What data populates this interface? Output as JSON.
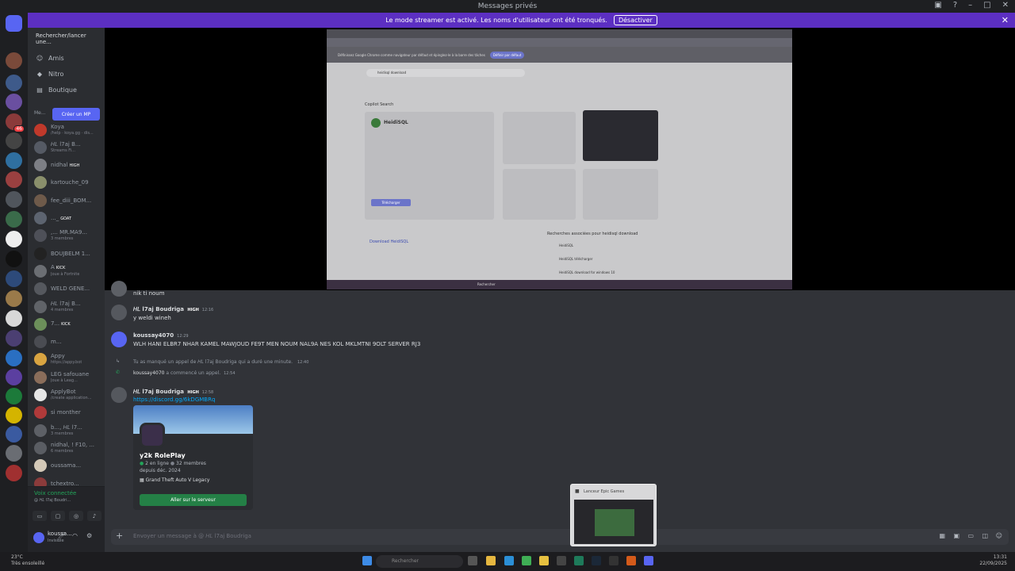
{
  "window": {
    "title": "Messages privés"
  },
  "streamer_bar": {
    "text": "Le mode streamer est activé. Les noms d'utilisateur ont été tronqués.",
    "button": "Désactiver"
  },
  "sidebar": {
    "search": "Rechercher/lancer une...",
    "nav": [
      {
        "label": "Amis",
        "icon": "friends-icon"
      },
      {
        "label": "Nitro",
        "icon": "nitro-icon"
      },
      {
        "label": "Boutique",
        "icon": "shop-icon"
      }
    ],
    "dm_header": "Me...",
    "create_dm": "Créer un MP",
    "dms": [
      {
        "name": "Koya",
        "sub": "/help · koya.gg · dis...",
        "color": "#c0392b"
      },
      {
        "name": "𝐻𝐿 l7aj B...",
        "sub": "Streams Fi...",
        "color": "#555a64"
      },
      {
        "name": "nidhal",
        "tag": "HIGH",
        "color": "#7d7f85"
      },
      {
        "name": "kartouche_09",
        "color": "#8a8f6b"
      },
      {
        "name": "fee_diii_BOM...",
        "color": "#6e5a4a"
      },
      {
        "name": "..._",
        "tag": "GOAT",
        "color": "#5d6470"
      },
      {
        "name": ",... MR.MA9...",
        "sub": "3 membres",
        "color": "#4e5058"
      },
      {
        "name": "BOUJBELM 1...",
        "color": "#222"
      },
      {
        "name": "A",
        "tag": "KICK",
        "sub": "Joue à Fortnite",
        "color": "#6b6e73"
      },
      {
        "name": "WELD GENE...",
        "color": "#55585e"
      },
      {
        "name": "𝐻𝐿 l7aj B...",
        "sub": "4 membres",
        "color": "#606368"
      },
      {
        "name": "7...",
        "tag": "KICK",
        "color": "#6c8f5a"
      },
      {
        "name": "m...",
        "color": "#4a4c52"
      },
      {
        "name": "Appy",
        "sub": "https://appy.bot",
        "color": "#d9a441"
      },
      {
        "name": "LEG safouane",
        "sub": "Joue à Leag...",
        "color": "#8a6d5a"
      },
      {
        "name": "ApplyBot",
        "sub": "/create application...",
        "color": "#e6e6e6"
      },
      {
        "name": "si monther",
        "color": "#b03a3a"
      },
      {
        "name": "b..., 𝐻𝐿 l7...",
        "sub": "3 membres",
        "color": "#5d6066"
      },
      {
        "name": "nidhal, ! F10, ...",
        "sub": "6 membres",
        "color": "#5a5d63"
      },
      {
        "name": "oussama...",
        "color": "#d4c9b8"
      },
      {
        "name": "tchextro...",
        "color": "#8b3b3b"
      }
    ],
    "voice": {
      "status": "Voix connectée",
      "sub": "@ 𝐻𝐿 l7aj Boudri..."
    },
    "user": {
      "name": "koussa...",
      "status": "Invisible"
    }
  },
  "stream": {
    "infobar_text": "Définissez Google Chrome comme navigateur par défaut et épinglez-le à la barre des tâches",
    "infobar_button": "Définir par défaut",
    "search_query": "heidisql download",
    "copilot": "Copilot Search",
    "result_title": "HeidiSQL",
    "download_btn": "Télécharger",
    "related": "Recherches associées pour heidisql download",
    "related_items": [
      "HeidiSQL",
      "HeidiSQL télécharger",
      "HeidiSQL download for windows 10"
    ],
    "download_link": "Download HeidiSQL",
    "taskbar_search": "Rechercher"
  },
  "messages": [
    {
      "type": "tail",
      "text": "nik ti noum"
    },
    {
      "type": "msg",
      "author": "𝐻𝐿 l7aj Boudriga",
      "tag": "HIGH",
      "time": "12:16",
      "text": "y weldi wineh"
    },
    {
      "type": "msg",
      "author": "koussay4070",
      "time": "12:29",
      "text": "WLH HANI ELBR7 NHAR KAMEL MAWJOUD FE9T MEN NOUM NAL9A NES KOL MKLMTNI 9OLT SERVER RJ3"
    },
    {
      "type": "sys",
      "text": "Tu as manqué un appel de 𝐻𝐿 l7aj Boudriga qui a duré une minute.",
      "time": "12:40"
    },
    {
      "type": "sys",
      "author": "koussay4070",
      "text": "a commencé un appel.",
      "time": "12:54"
    },
    {
      "type": "msg",
      "author": "𝐻𝐿 l7aj Boudriga",
      "tag": "HIGH",
      "time": "12:58",
      "link": "https://discord.gg/6kDGMBRq"
    }
  ],
  "invite": {
    "name": "y2k RolePlay",
    "online": "2 en ligne",
    "members": "32 membres",
    "since": "depuis déc. 2024",
    "game": "Grand Theft Auto V Legacy",
    "join": "Aller sur le serveur"
  },
  "composer": {
    "placeholder": "Envoyer un message à @ 𝐻𝐿 l7aj Boudriga"
  },
  "popup": {
    "title": "Lanceur Epic Games"
  },
  "taskbar": {
    "weather_temp": "23°C",
    "weather_desc": "Très ensoleillé",
    "search": "Rechercher",
    "time": "13:31",
    "date": "22/09/2025"
  },
  "colors": {
    "accent": "#5865f2",
    "streamer": "#5c2fc2",
    "join": "#248046",
    "link": "#00a8fc"
  }
}
